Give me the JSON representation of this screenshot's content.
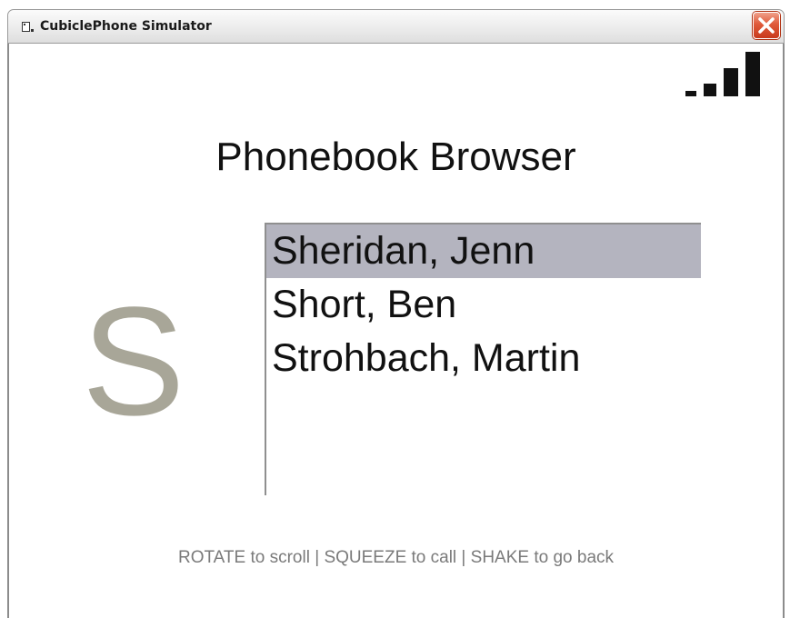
{
  "window": {
    "title": "CubiclePhone Simulator"
  },
  "screen": {
    "heading": "Phonebook Browser",
    "index_letter": "S",
    "signal_bars": 4,
    "contacts": [
      {
        "name": "Sheridan, Jenn",
        "selected": true
      },
      {
        "name": "Short, Ben",
        "selected": false
      },
      {
        "name": "Strohbach, Martin",
        "selected": false
      }
    ],
    "hint": "ROTATE to scroll | SQUEEZE to call | SHAKE to go back"
  },
  "colors": {
    "selection": "#b4b4bf",
    "index_letter": "#a8a698",
    "close_button": "#e05a3a"
  },
  "icons": [
    "app-window-icon",
    "close-icon",
    "signal-strength-icon"
  ]
}
